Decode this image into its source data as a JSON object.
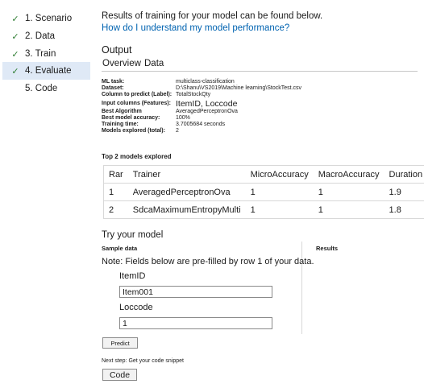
{
  "sidebar": {
    "items": [
      {
        "label": "1. Scenario",
        "checked": true
      },
      {
        "label": "2. Data",
        "checked": true
      },
      {
        "label": "3. Train",
        "checked": true
      },
      {
        "label": "4. Evaluate",
        "checked": true,
        "active": true
      },
      {
        "label": "5. Code",
        "checked": false
      }
    ],
    "check_glyph": "✓"
  },
  "main": {
    "intro": "Results of training for your model can be found below.",
    "help_link": "How do I understand my model performance?",
    "output_title": "Output",
    "tabs": [
      "Overview",
      "Data"
    ]
  },
  "info": [
    {
      "key": "ML task:",
      "value": "multiclass-classification"
    },
    {
      "key": "Dataset:",
      "value": "D:\\Shanu\\VS2019\\Machine learning\\StockTest.csv"
    },
    {
      "key": "Column to predict (Label):",
      "value": "TotalStockQty"
    },
    {
      "key": "Input columns (Features):",
      "value": "ItemID, Loccode"
    },
    {
      "key": "Best Algorithm",
      "value": "AveragedPerceptronOva"
    },
    {
      "key": "Best model accuracy:",
      "value": "100%"
    },
    {
      "key": "Training time:",
      "value": "3.7005684 seconds"
    },
    {
      "key": "Models explored (total):",
      "value": "2"
    }
  ],
  "top_models": {
    "title": "Top 2 models explored",
    "headers": [
      "Rar",
      "Trainer",
      "MicroAccuracy",
      "MacroAccuracy",
      "Duration"
    ],
    "rows": [
      [
        "1",
        "AveragedPerceptronOva",
        "1",
        "1",
        "1.9"
      ],
      [
        "2",
        "SdcaMaximumEntropyMulti",
        "1",
        "1",
        "1.8"
      ]
    ]
  },
  "try_model": {
    "title": "Try your model",
    "sample_title": "Sample data",
    "results_title": "Results",
    "note": "Note: Fields below are pre-filled by row 1 of your data.",
    "fields": [
      {
        "label": "ItemID",
        "value": "Item001"
      },
      {
        "label": "Loccode",
        "value": "1"
      }
    ],
    "predict_label": "Predict",
    "next_step": "Next step: Get your code snippet",
    "code_label": "Code"
  },
  "colors": {
    "accent": "#0063b1",
    "check": "#2e7d32",
    "active_bg": "#dfe9f6"
  }
}
